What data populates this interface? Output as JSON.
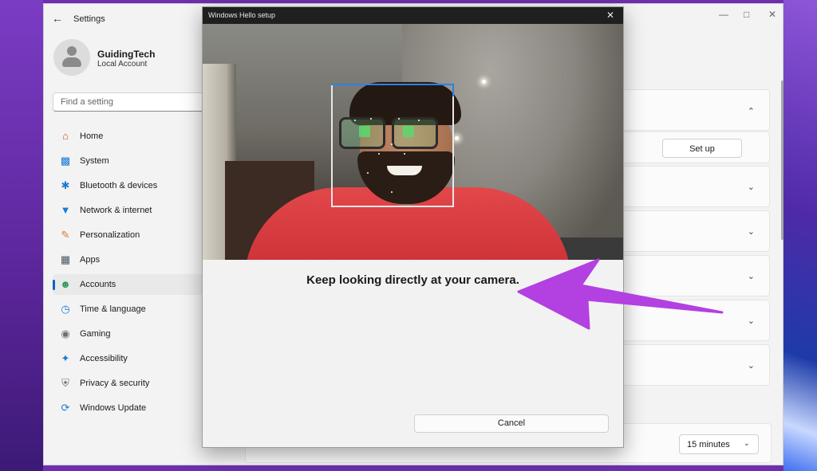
{
  "settings_window": {
    "title": "Settings",
    "back_icon": "arrow-left-icon",
    "window_controls": [
      "minimize-icon",
      "maximize-icon",
      "close-icon"
    ]
  },
  "profile": {
    "name": "GuidingTech",
    "account_type": "Local Account"
  },
  "search": {
    "placeholder": "Find a setting"
  },
  "sidebar": {
    "items": [
      {
        "label": "Home",
        "icon": "home-icon",
        "active": false
      },
      {
        "label": "System",
        "icon": "monitor-icon",
        "active": false
      },
      {
        "label": "Bluetooth & devices",
        "icon": "bluetooth-icon",
        "active": false
      },
      {
        "label": "Network & internet",
        "icon": "wifi-icon",
        "active": false
      },
      {
        "label": "Personalization",
        "icon": "brush-icon",
        "active": false
      },
      {
        "label": "Apps",
        "icon": "apps-icon",
        "active": false
      },
      {
        "label": "Accounts",
        "icon": "person-icon",
        "active": true
      },
      {
        "label": "Time & language",
        "icon": "globe-clock-icon",
        "active": false
      },
      {
        "label": "Gaming",
        "icon": "gamepad-icon",
        "active": false
      },
      {
        "label": "Accessibility",
        "icon": "accessibility-icon",
        "active": false
      },
      {
        "label": "Privacy & security",
        "icon": "shield-icon",
        "active": false
      },
      {
        "label": "Windows Update",
        "icon": "update-icon",
        "active": false
      }
    ]
  },
  "content": {
    "setup_button": "Set up",
    "timeout_select": "15 minutes"
  },
  "dialog": {
    "title": "Windows Hello setup",
    "instruction": "Keep looking directly at your camera.",
    "cancel_label": "Cancel"
  },
  "colors": {
    "accent": "#0067c0",
    "face_frame": "#2b82e6",
    "arrow": "#b340e0"
  }
}
